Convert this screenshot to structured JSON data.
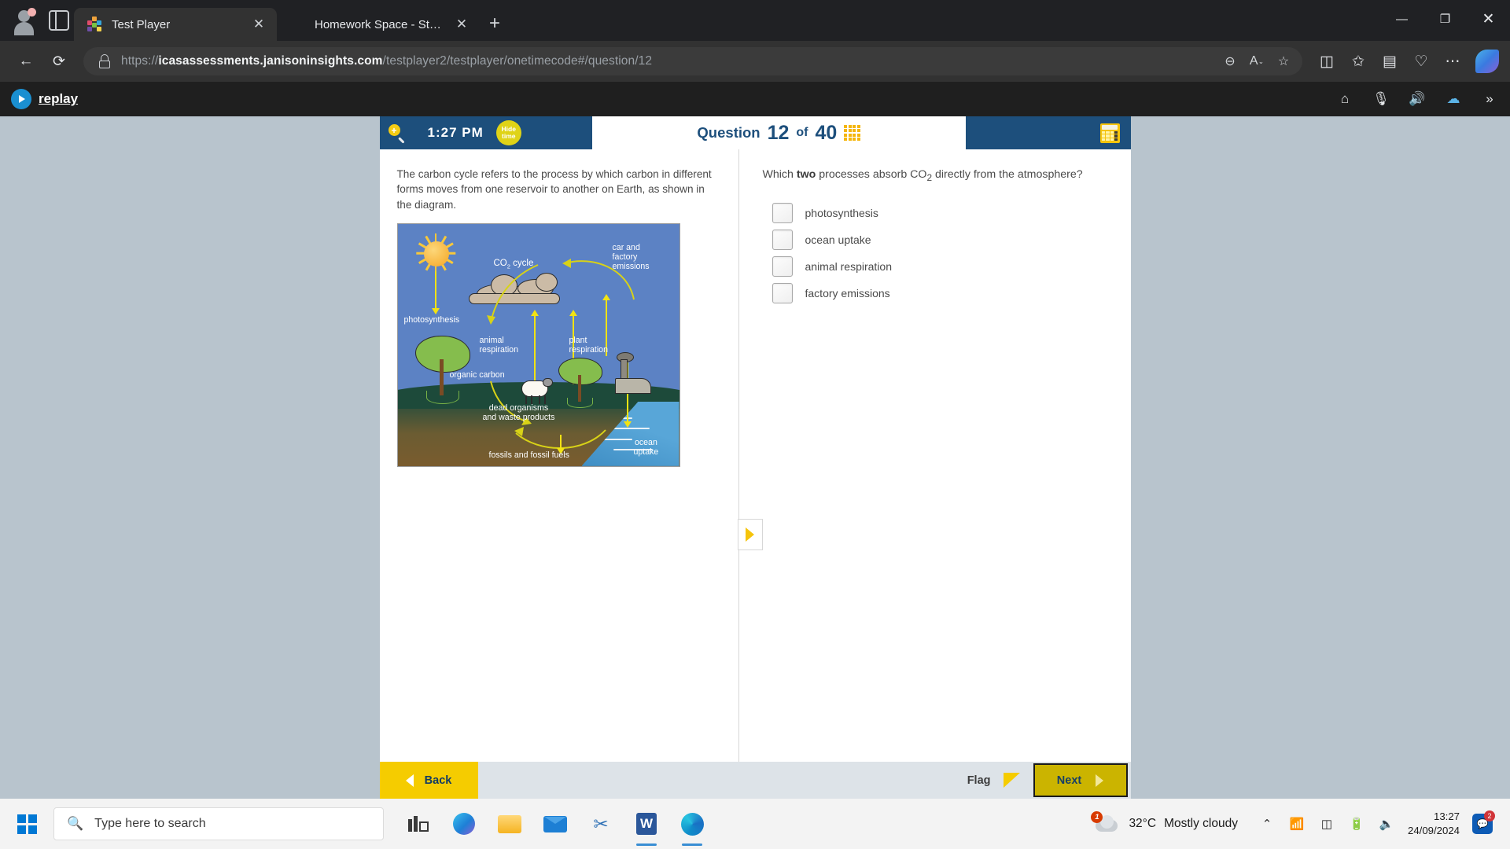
{
  "browser": {
    "tabs": [
      {
        "title": "Test Player",
        "favicon": "testplayer-icon",
        "active": true,
        "close_label": "✕"
      },
      {
        "title": "Homework Space - StudyX",
        "favicon": "studyx-gem-icon",
        "active": false,
        "close_label": "✕"
      }
    ],
    "new_tab_label": "+",
    "url": {
      "scheme": "https://",
      "domain": "icasassessments.janisoninsights.com",
      "path": "/testplayer2/testplayer/onetimecode#/question/12",
      "full": "https://icasassessments.janisoninsights.com/testplayer2/testplayer/onetimecode#/question/12"
    },
    "window_controls": {
      "minimize": "—",
      "maximize": "❐",
      "close": "✕"
    },
    "nav": {
      "back": "←",
      "reload": "⟳"
    },
    "omnibox_icons": [
      "zoom-out-icon",
      "read-aloud-icon",
      "favorite-star-icon"
    ],
    "toolbar_icons": [
      "split-screen-icon",
      "favorites-icon",
      "collections-icon",
      "browser-essentials-icon",
      "settings-more-icon",
      "copilot-icon"
    ]
  },
  "replay_bar": {
    "brand": "replay",
    "icons": [
      "home-icon",
      "microphone-icon",
      "speaker-icon",
      "cloud-icon",
      "chevrons-right-icon"
    ]
  },
  "test_player": {
    "zoom_icon": "magnifier-plus-icon",
    "time": "1:27  PM",
    "hide_time_button": {
      "line1": "Hide",
      "line2": "time"
    },
    "question_label": "Question",
    "question_number": "12",
    "of_label": "of",
    "question_total": "40",
    "grid_icon": "question-grid-icon",
    "calculator_icon": "calculator-icon",
    "stimulus": "The carbon cycle refers to the process by which carbon in different forms moves from one reservoir to another on Earth, as shown in the diagram.",
    "question": {
      "prefix": "Which ",
      "bold": "two",
      "suffix": " processes absorb CO",
      "sub": "2",
      "tail": " directly from the atmosphere?"
    },
    "options": [
      {
        "label": "photosynthesis",
        "checked": false
      },
      {
        "label": "ocean uptake",
        "checked": false
      },
      {
        "label": "animal respiration",
        "checked": false
      },
      {
        "label": "factory emissions",
        "checked": false
      }
    ],
    "footer": {
      "back_label": "Back",
      "flag_label": "Flag",
      "flag_icon": "flag-icon",
      "next_label": "Next"
    },
    "pane_handle_icon": "expand-pane-arrow-icon"
  },
  "diagram": {
    "alt": "carbon cycle diagram",
    "labels": {
      "co2_cycle_a": "CO",
      "co2_cycle_sub": "2",
      "co2_cycle_b": " cycle",
      "car_factory": "car and\nfactory\nemissions",
      "photosynthesis": "photosynthesis",
      "animal_respiration": "animal\nrespiration",
      "plant_respiration": "plant\nrespiration",
      "organic_carbon": "organic carbon",
      "dead_organisms": "dead organisms\nand waste products",
      "fossils": "fossils and fossil fuels",
      "ocean_uptake": "ocean\nuptake"
    },
    "colors": {
      "sky": "#5c82c4",
      "grass": "#1d4a3a",
      "soil": "#7a5c2e",
      "arrow": "#f2e313",
      "water": "#4a97cd"
    }
  },
  "taskbar": {
    "start_icon": "windows-start-icon",
    "search_placeholder": "Type here to search",
    "search_icon": "search-icon",
    "apps": [
      "task-view-icon",
      "edge-copilot-icon",
      "file-explorer-icon",
      "mail-icon",
      "snip-tool-icon",
      "word-icon",
      "edge-icon"
    ],
    "weather": {
      "temperature": "32°C",
      "condition": "Mostly cloudy",
      "badge": "1"
    },
    "tray_icons": [
      "show-hidden-icons-chevron",
      "wifi-icon",
      "battery-charging-icon",
      "battery-icon",
      "volume-icon"
    ],
    "clock": {
      "time": "13:27",
      "date": "24/09/2024"
    },
    "notification_count": "2"
  },
  "colors": {
    "tp_blue": "#1d4f7c",
    "tp_yellow": "#f5cc00",
    "next_yellow": "#cbb400",
    "footer_grey": "#dde3e8",
    "side_grey": "#b8c4cd"
  }
}
